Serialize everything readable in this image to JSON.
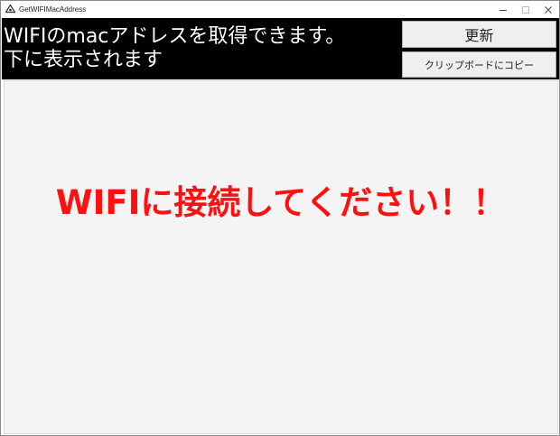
{
  "window": {
    "title": "GetWIFIMacAddress",
    "app_icon": "app-icon",
    "controls": [
      "minimize-icon",
      "maximize-icon",
      "close-icon"
    ]
  },
  "header": {
    "message_line1": "WIFIのmacアドレスを取得できます。",
    "message_line2": "下に表示されます",
    "refresh_label": "更新",
    "copy_label": "クリップボードにコピー"
  },
  "content": {
    "status_text": "WIFIに接続してください！！",
    "status_color": "#ff1010"
  }
}
